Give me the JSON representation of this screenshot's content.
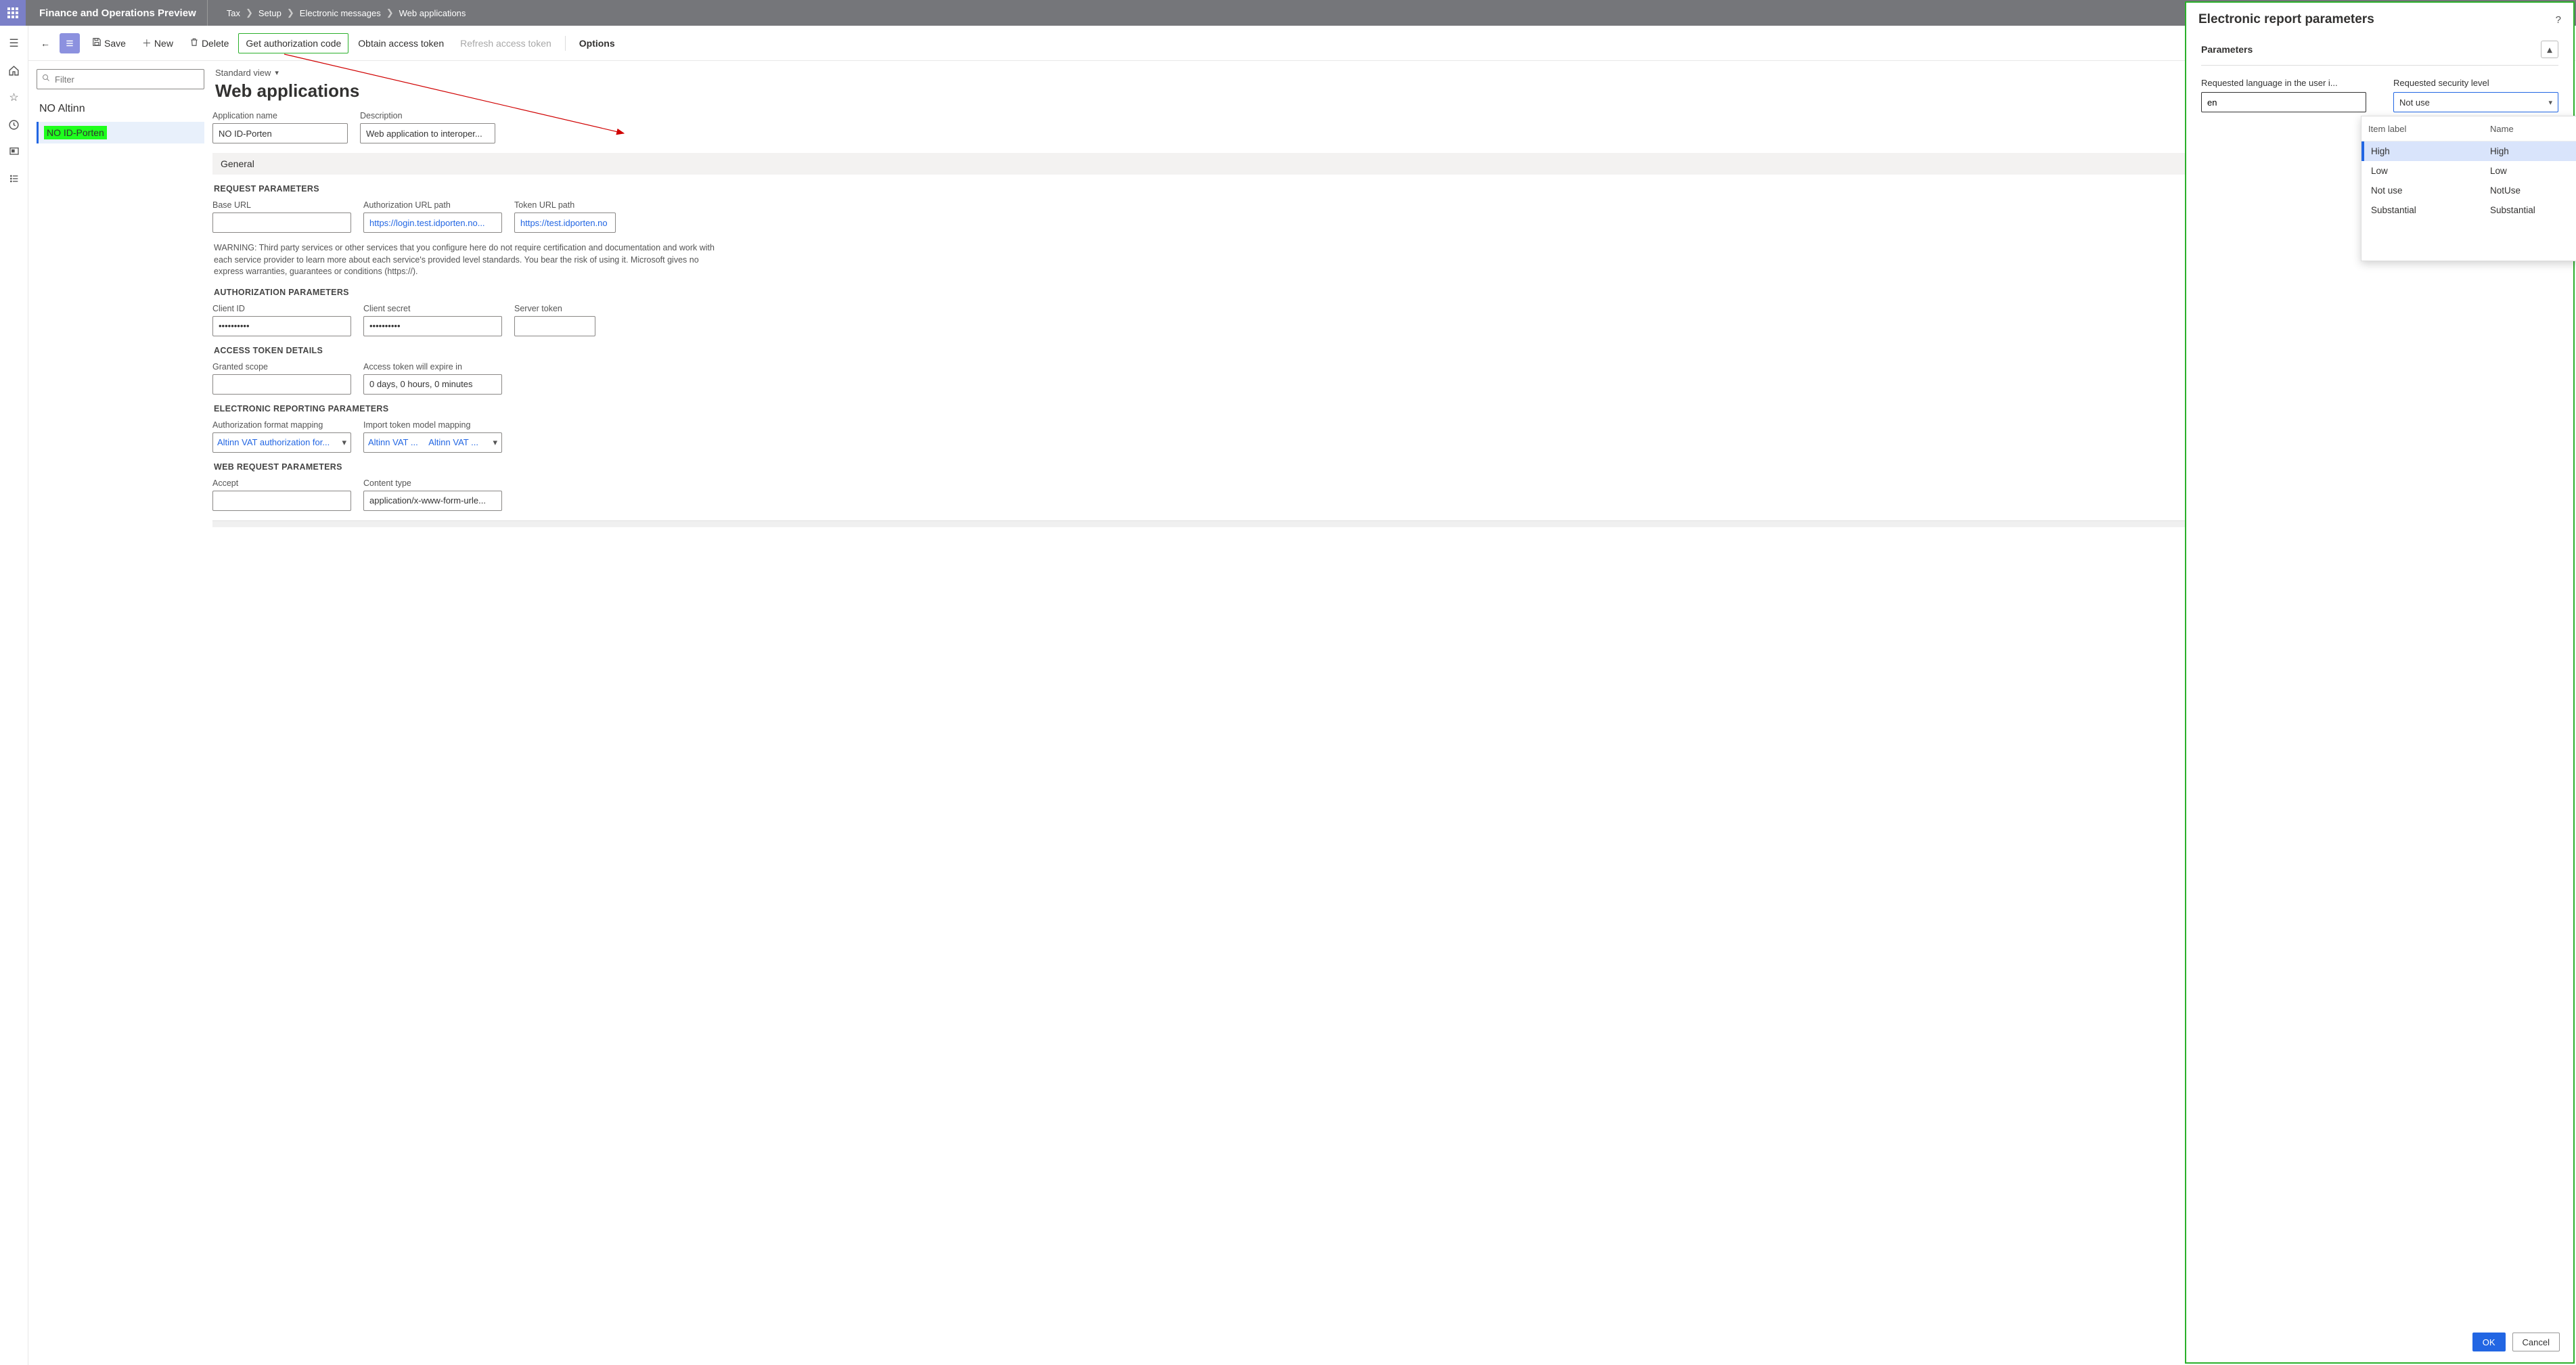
{
  "header": {
    "app_title": "Finance and Operations Preview",
    "breadcrumb": [
      "Tax",
      "Setup",
      "Electronic messages",
      "Web applications"
    ]
  },
  "actions": {
    "save": "Save",
    "new": "New",
    "delete": "Delete",
    "get_auth": "Get authorization code",
    "obtain_token": "Obtain access token",
    "refresh_token": "Refresh access token",
    "options": "Options"
  },
  "list": {
    "filter_placeholder": "Filter",
    "group": "NO Altinn",
    "items": [
      {
        "label": "NO ID-Porten",
        "selected": true,
        "highlight": true
      }
    ]
  },
  "detail": {
    "view_label": "Standard view",
    "title": "Web applications",
    "fields": {
      "app_name_label": "Application name",
      "app_name_value": "NO ID-Porten",
      "desc_label": "Description",
      "desc_value": "Web application to interoper..."
    },
    "general_label": "General",
    "req_params_label": "REQUEST PARAMETERS",
    "base_url_label": "Base URL",
    "base_url_value": "",
    "auth_url_label": "Authorization URL path",
    "auth_url_value": "https://login.test.idporten.no...",
    "token_url_label": "Token URL path",
    "token_url_value": "https://test.idporten.no",
    "warning": "WARNING: Third party services or other services that you configure here do not require certification and documentation and work with each service provider to learn more about each service's provided level standards. You bear the risk of using it. Microsoft gives no express warranties, guarantees or conditions (https://).",
    "auth_params_label": "AUTHORIZATION PARAMETERS",
    "client_id_label": "Client ID",
    "client_id_value": "••••••••••",
    "client_secret_label": "Client secret",
    "client_secret_value": "••••••••••",
    "server_token_label": "Server token",
    "server_token_value": "",
    "access_token_label": "ACCESS TOKEN DETAILS",
    "granted_scope_label": "Granted scope",
    "granted_scope_value": "",
    "expire_label": "Access token will expire in",
    "expire_value": "0 days, 0 hours, 0 minutes",
    "er_params_label": "ELECTRONIC REPORTING PARAMETERS",
    "auth_fmt_label": "Authorization format mapping",
    "auth_fmt_value": "Altinn VAT authorization for...",
    "import_map_label": "Import token model mapping",
    "import_map_value_a": "Altinn VAT ...",
    "import_map_value_b": "Altinn VAT ...",
    "web_req_label": "WEB REQUEST PARAMETERS",
    "accept_label": "Accept",
    "accept_value": "",
    "content_type_label": "Content type",
    "content_type_value": "application/x-www-form-urle..."
  },
  "flyout": {
    "title": "Electronic report parameters",
    "section": "Parameters",
    "lang_label": "Requested language in the user i...",
    "lang_value": "en",
    "sec_label": "Requested security level",
    "sec_value": "Not use",
    "dd_cols": {
      "c1": "Item label",
      "c2": "Name"
    },
    "options": [
      {
        "label": "High",
        "name": "High",
        "selected": true
      },
      {
        "label": "Low",
        "name": "Low"
      },
      {
        "label": "Not use",
        "name": "NotUse"
      },
      {
        "label": "Substantial",
        "name": "Substantial"
      }
    ],
    "ok": "OK",
    "cancel": "Cancel"
  }
}
